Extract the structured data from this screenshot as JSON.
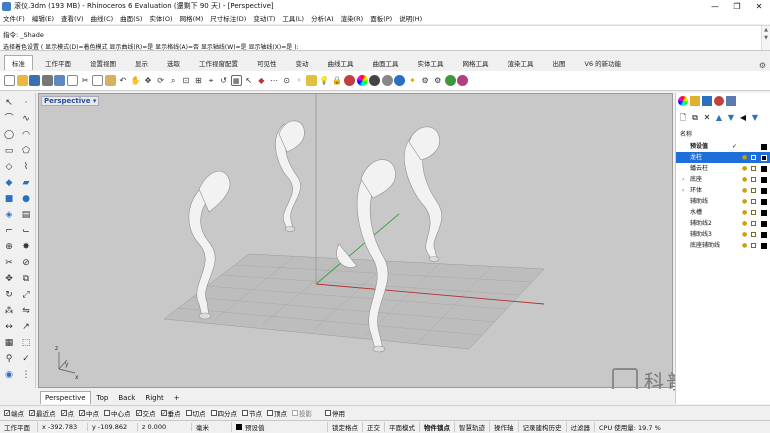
{
  "window": {
    "title": "滚仪.3dm (193 MB) - Rhinoceros 6 Evaluation (還剩下 90 天) - [Perspective]",
    "minimize": "—",
    "maximize": "❐",
    "close": "✕"
  },
  "menu": [
    "文件(F)",
    "编辑(E)",
    "查看(V)",
    "曲线(C)",
    "曲面(S)",
    "实体(O)",
    "网格(M)",
    "尺寸标注(D)",
    "变动(T)",
    "工具(L)",
    "分析(A)",
    "渲染(R)",
    "面板(P)",
    "说明(H)"
  ],
  "command": {
    "history": "指令: _Shade",
    "prompt": "选择着色设置 ( 显示模式(D)=着色模式  显示曲线(R)=是  显示格线(A)=否  显示轴线(W)=是  显示轴线(X)=是 ):"
  },
  "tabs": [
    "标准",
    "工作平面",
    "设置视图",
    "显示",
    "选取",
    "工作视窗配置",
    "可见性",
    "变动",
    "曲线工具",
    "曲面工具",
    "实体工具",
    "网格工具",
    "渲染工具",
    "出图",
    "V6 的新功能"
  ],
  "viewport": {
    "title": "Perspective",
    "tabs": [
      "Perspective",
      "Top",
      "Back",
      "Right"
    ],
    "add_tab": "+",
    "axis_x": "x",
    "axis_y": "y",
    "axis_z": "z"
  },
  "layers": {
    "header": "名称",
    "items": [
      {
        "name": "预设值",
        "selected": false,
        "expandable": false,
        "current": true
      },
      {
        "name": "龙柱",
        "selected": true,
        "expandable": false,
        "current": false
      },
      {
        "name": "蟠云柱",
        "selected": false,
        "expandable": false,
        "current": false
      },
      {
        "name": "底座",
        "selected": false,
        "expandable": true,
        "current": false
      },
      {
        "name": "环体",
        "selected": false,
        "expandable": true,
        "current": false
      },
      {
        "name": "辅助线",
        "selected": false,
        "expandable": false,
        "current": false
      },
      {
        "name": "水槽",
        "selected": false,
        "expandable": false,
        "current": false
      },
      {
        "name": "辅助线2",
        "selected": false,
        "expandable": false,
        "current": false
      },
      {
        "name": "辅助线3",
        "selected": false,
        "expandable": false,
        "current": false
      },
      {
        "name": "底座辅助线",
        "selected": false,
        "expandable": false,
        "current": false
      }
    ],
    "current_mark": "✓"
  },
  "osnap": [
    {
      "label": "端点",
      "checked": true
    },
    {
      "label": "最近点",
      "checked": true
    },
    {
      "label": "点",
      "checked": true
    },
    {
      "label": "中点",
      "checked": true
    },
    {
      "label": "中心点",
      "checked": false
    },
    {
      "label": "交点",
      "checked": true
    },
    {
      "label": "垂点",
      "checked": true
    },
    {
      "label": "切点",
      "checked": false
    },
    {
      "label": "四分点",
      "checked": false
    },
    {
      "label": "节点",
      "checked": false
    },
    {
      "label": "顶点",
      "checked": false
    },
    {
      "label": "投影",
      "checked": false
    },
    {
      "label": "停用",
      "checked": false
    }
  ],
  "status": {
    "plane": "工作平面",
    "x": "x -392.783",
    "y": "y -109.862",
    "z": "z 0.000",
    "unit": "毫米",
    "layer": "预设值",
    "items": [
      "锁定格点",
      "正交",
      "平面模式",
      "物件锁点",
      "智慧轨迹",
      "操作轴",
      "记录建构历史",
      "过滤器",
      "CPU 使用量: 19.7 %"
    ]
  },
  "watermark": "科普云",
  "colors": {
    "viewport_bg": "#c8c8c8",
    "grid": "#a8a8a8",
    "axis_red": "#b03030",
    "axis_green": "#30a040",
    "layer_selected": "#1e6fd9"
  }
}
